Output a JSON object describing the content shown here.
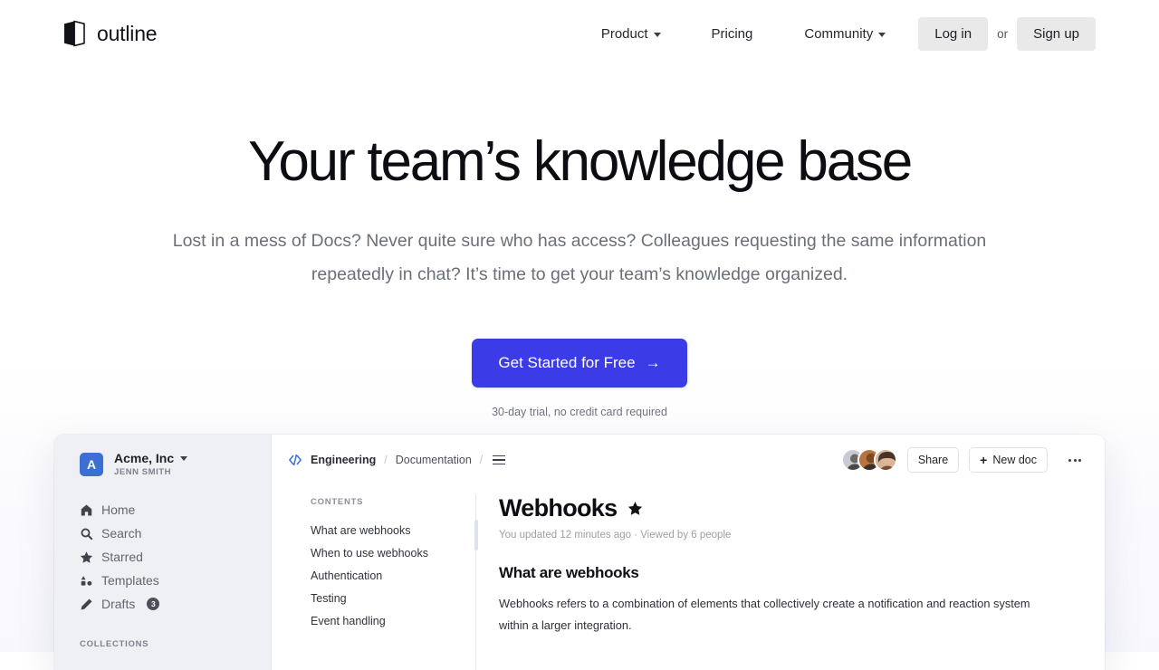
{
  "header": {
    "logo_icon": "outline-book-icon",
    "brand": "outline",
    "nav": [
      {
        "label": "Product",
        "has_caret": true,
        "icon": "chevron-down-icon"
      },
      {
        "label": "Pricing",
        "has_caret": false
      },
      {
        "label": "Community",
        "has_caret": true,
        "icon": "chevron-down-icon"
      }
    ],
    "login_label": "Log in",
    "or_label": "or",
    "signup_label": "Sign up"
  },
  "hero": {
    "title": "Your team’s knowledge base",
    "subtitle": "Lost in a mess of Docs? Never quite sure who has access? Colleagues requesting the same information repeatedly in chat? It’s time to get your team’s knowledge organized.",
    "cta_label": "Get Started for Free",
    "cta_arrow": "→",
    "cta_note": "30-day trial, no credit card required",
    "cta_color": "#3b3ce8"
  },
  "app_preview": {
    "sidebar": {
      "avatar_letter": "A",
      "avatar_color": "#3b6fd4",
      "team_name": "Acme, Inc",
      "team_caret_icon": "chevron-down-icon",
      "user_name": "JENN SMITH",
      "items": [
        {
          "label": "Home",
          "icon": "home-icon"
        },
        {
          "label": "Search",
          "icon": "search-icon"
        },
        {
          "label": "Starred",
          "icon": "star-icon"
        },
        {
          "label": "Templates",
          "icon": "templates-icon"
        },
        {
          "label": "Drafts",
          "icon": "pencil-icon",
          "badge": "3"
        }
      ],
      "collections_label": "COLLECTIONS"
    },
    "topbar": {
      "breadcrumb_icon": "code-brackets-icon",
      "breadcrumb": [
        {
          "label": "Engineering"
        },
        {
          "label": "Documentation"
        }
      ],
      "separator": "/",
      "toc_toggle_icon": "table-of-contents-icon",
      "share_label": "Share",
      "new_doc_label": "New doc",
      "new_doc_icon": "plus-icon",
      "more_icon": "more-horizontal-icon",
      "collaborator_count": 3
    },
    "contents": {
      "heading": "CONTENTS",
      "items": [
        "What are webhooks",
        "When to use webhooks",
        "Authentication",
        "Testing",
        "Event handling"
      ]
    },
    "document": {
      "title": "Webhooks",
      "starred_icon": "star-filled-icon",
      "meta": "You updated 12 minutes ago · Viewed by 6 people",
      "section_heading": "What are webhooks",
      "paragraph": "Webhooks refers to a combination of elements that collectively create a notification and reaction system within a larger integration."
    }
  }
}
